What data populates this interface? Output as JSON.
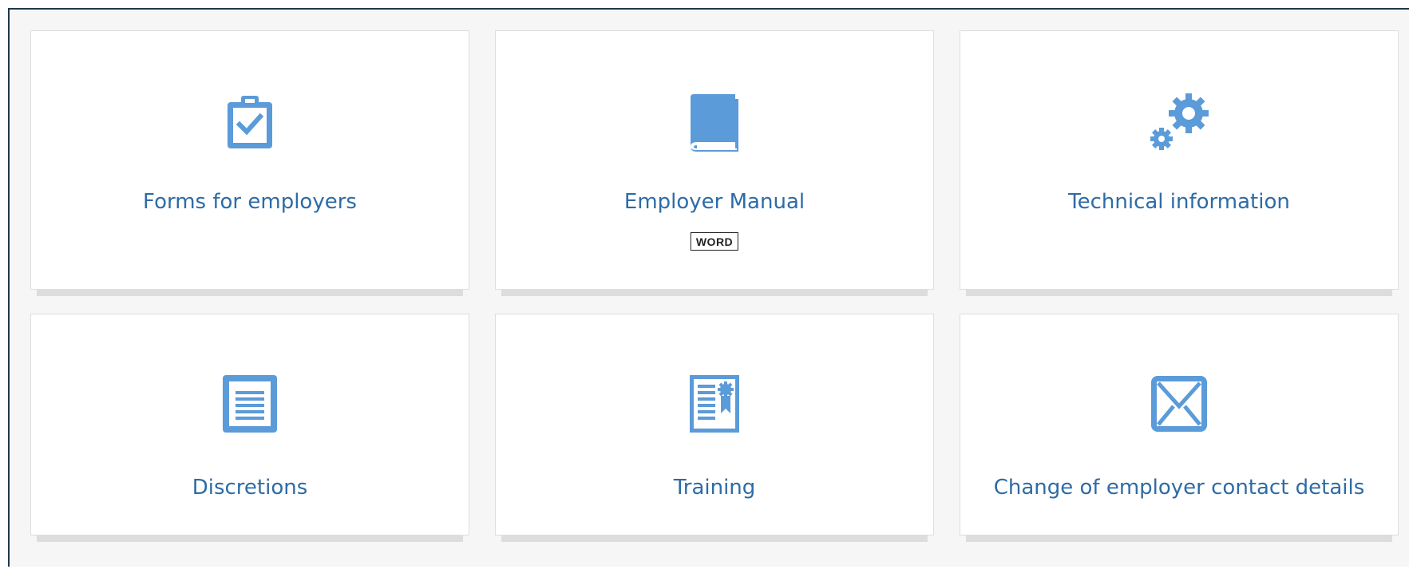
{
  "tiles": [
    {
      "label": "Forms for employers",
      "icon": "clipboard-check-icon"
    },
    {
      "label": "Employer Manual",
      "icon": "book-icon",
      "badge": "WORD"
    },
    {
      "label": "Technical information",
      "icon": "gears-icon"
    },
    {
      "label": "Discretions",
      "icon": "document-lines-icon"
    },
    {
      "label": "Training",
      "icon": "certificate-icon"
    },
    {
      "label": "Change of employer contact details",
      "icon": "envelope-icon"
    }
  ],
  "colors": {
    "icon": "#5b9bd9",
    "link_text": "#2e6ba6",
    "tile_background": "#ffffff",
    "page_background": "#f6f6f6",
    "tile_shadow": "#dddddd"
  }
}
